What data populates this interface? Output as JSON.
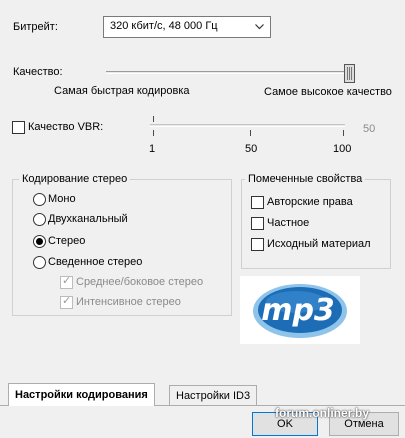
{
  "bitrate": {
    "label": "Битрейт:",
    "value": "320 кбит/с, 48 000 Гц"
  },
  "quality": {
    "label": "Качество:",
    "left_caption": "Самая быстрая кодировка",
    "right_caption": "Самое высокое качество",
    "level": 1.0
  },
  "vbr": {
    "label": "Качество VBR:",
    "checked": false,
    "current_value": "50",
    "ticks": {
      "min": "1",
      "mid": "50",
      "max": "100"
    }
  },
  "stereo": {
    "title": "Кодирование стерео",
    "options": [
      {
        "label": "Моно",
        "selected": false
      },
      {
        "label": "Двухканальный",
        "selected": false
      },
      {
        "label": "Стерео",
        "selected": true
      },
      {
        "label": "Сведенное стерео",
        "selected": false
      }
    ],
    "sub_options": [
      {
        "label": "Среднее/боковое стерео",
        "checked": true,
        "enabled": false
      },
      {
        "label": "Интенсивное стерео",
        "checked": true,
        "enabled": false
      }
    ]
  },
  "flags": {
    "title": "Помеченные свойства",
    "items": [
      {
        "label": "Авторские права",
        "checked": false
      },
      {
        "label": "Частное",
        "checked": false
      },
      {
        "label": "Исходный материал",
        "checked": false
      }
    ]
  },
  "logo": {
    "text": "mp3",
    "colors": {
      "primary": "#1c6db5",
      "light": "#8ec3ea"
    }
  },
  "tabs": [
    {
      "label": "Настройки кодирования",
      "active": true
    },
    {
      "label": "Настройки ID3",
      "active": false
    }
  ],
  "buttons": {
    "ok": "OK",
    "cancel": "Отмена"
  },
  "watermark": "forum.onliner.by"
}
